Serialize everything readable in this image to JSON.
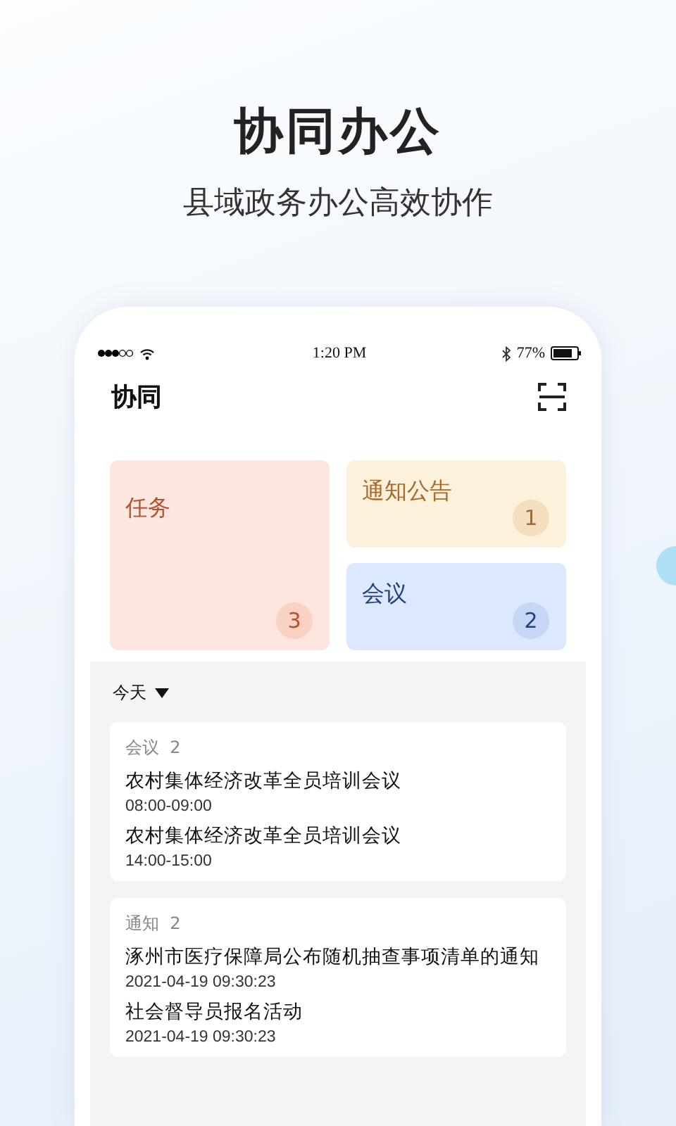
{
  "promo": {
    "headline": "协同办公",
    "tagline": "县域政务办公高效协作"
  },
  "status_bar": {
    "time": "1:20 PM",
    "battery": "77%"
  },
  "app_bar": {
    "title": "协同"
  },
  "tiles": [
    {
      "kind": "task",
      "label": "任务",
      "count": "3"
    },
    {
      "kind": "notice",
      "label": "通知公告",
      "count": "1"
    },
    {
      "kind": "meeting",
      "label": "会议",
      "count": "2"
    }
  ],
  "filter": {
    "label": "今天"
  },
  "groups": [
    {
      "label": "会议",
      "count": "2",
      "items": [
        {
          "title": "农村集体经济改革全员培训会议",
          "time": "08:00-09:00"
        },
        {
          "title": "农村集体经济改革全员培训会议",
          "time": "14:00-15:00"
        }
      ]
    },
    {
      "label": "通知",
      "count": "2",
      "items": [
        {
          "title": "涿州市医疗保障局公布随机抽查事项清单的通知",
          "time": "2021-04-19 09:30:23"
        },
        {
          "title": "社会督导员报名活动",
          "time": "2021-04-19 09:30:23"
        }
      ]
    }
  ]
}
